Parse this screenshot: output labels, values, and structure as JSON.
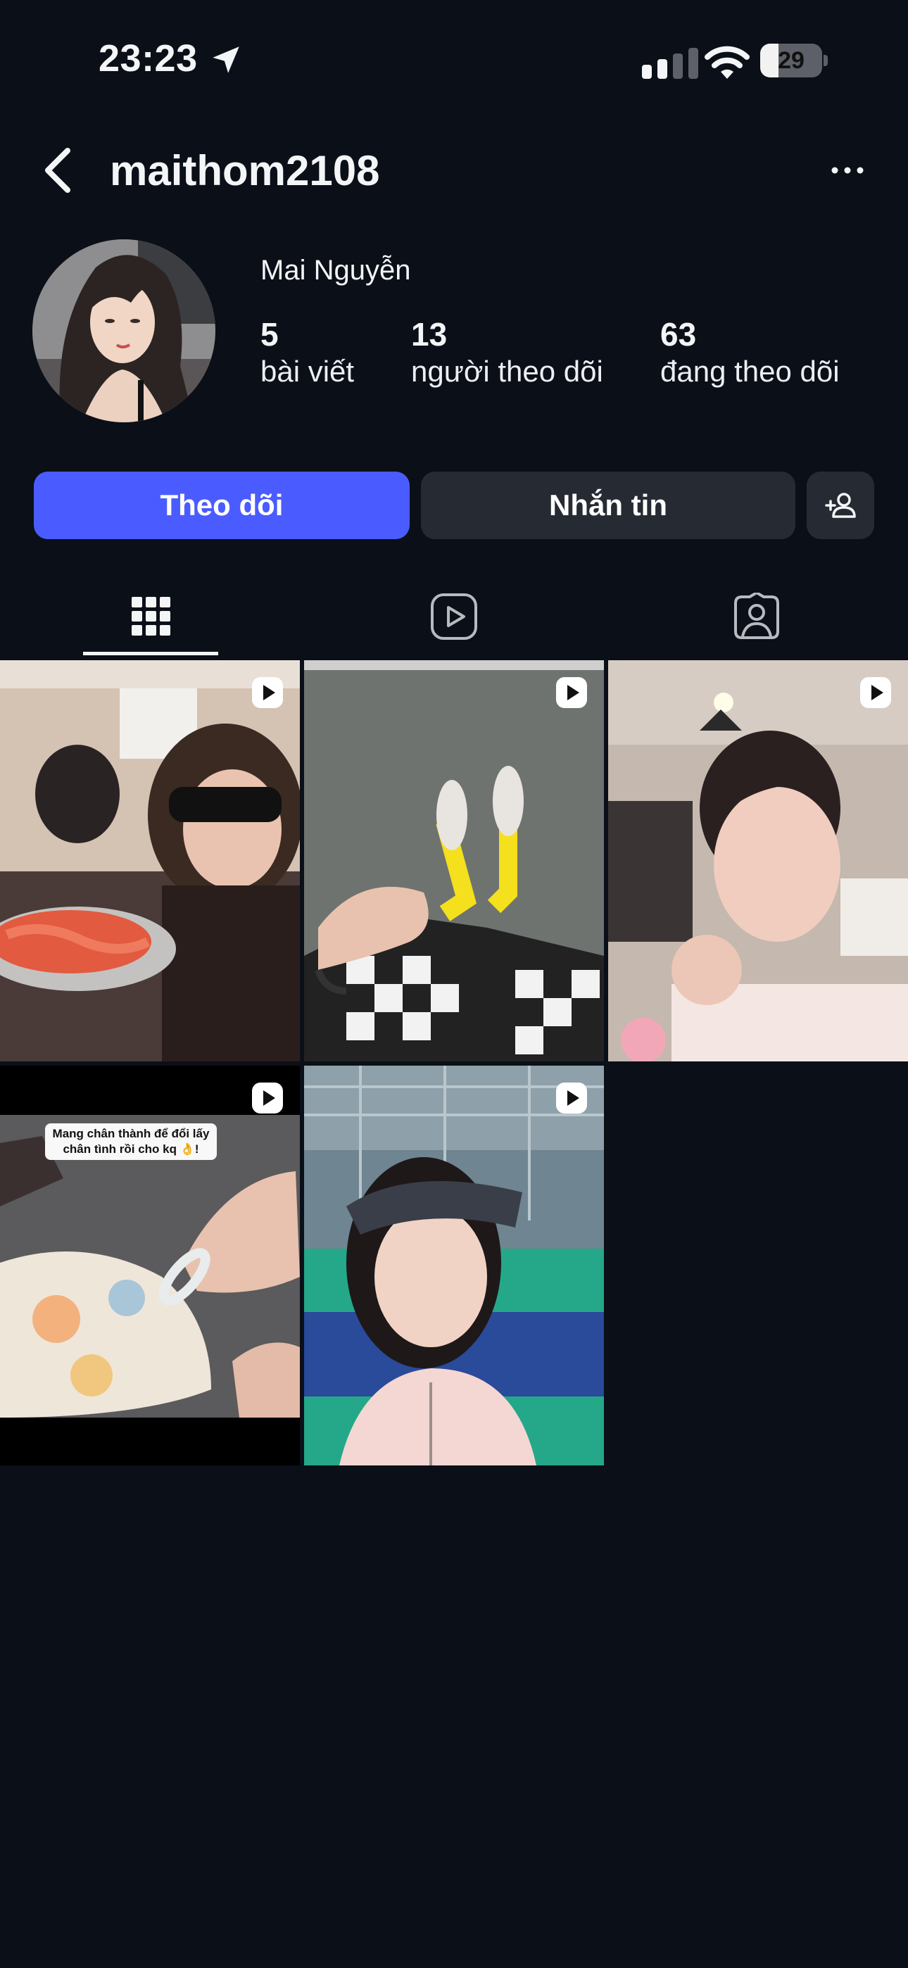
{
  "status_bar": {
    "time": "23:23",
    "battery_level": 29,
    "battery_label": "29"
  },
  "header": {
    "username": "maithom2108"
  },
  "profile": {
    "display_name": "Mai Nguyễn",
    "stats": [
      {
        "value": "5",
        "label": "bài viết"
      },
      {
        "value": "13",
        "label": "người theo dõi"
      },
      {
        "value": "63",
        "label": "đang theo dõi"
      }
    ]
  },
  "actions": {
    "follow_label": "Theo dõi",
    "message_label": "Nhắn tin"
  },
  "tabs": [
    {
      "icon": "grid-icon",
      "active": true
    },
    {
      "icon": "reels-icon",
      "active": false
    },
    {
      "icon": "tagged-icon",
      "active": false
    }
  ],
  "posts": [
    {
      "type": "reel",
      "scene": "woman with sunglasses holding a plate of shrimp"
    },
    {
      "type": "reel",
      "scene": "legs with yellow socks and checkered skirt"
    },
    {
      "type": "reel",
      "scene": "woman selfie in restaurant"
    },
    {
      "type": "reel",
      "caption": "Mang chân thành để đổi lấy chân tình rồi cho kq 👌!"
    },
    {
      "type": "reel",
      "scene": "woman with visor at badminton court"
    }
  ],
  "colors": {
    "background": "#0b0f18",
    "follow_button": "#4a5cff",
    "secondary_button": "#262b33"
  }
}
